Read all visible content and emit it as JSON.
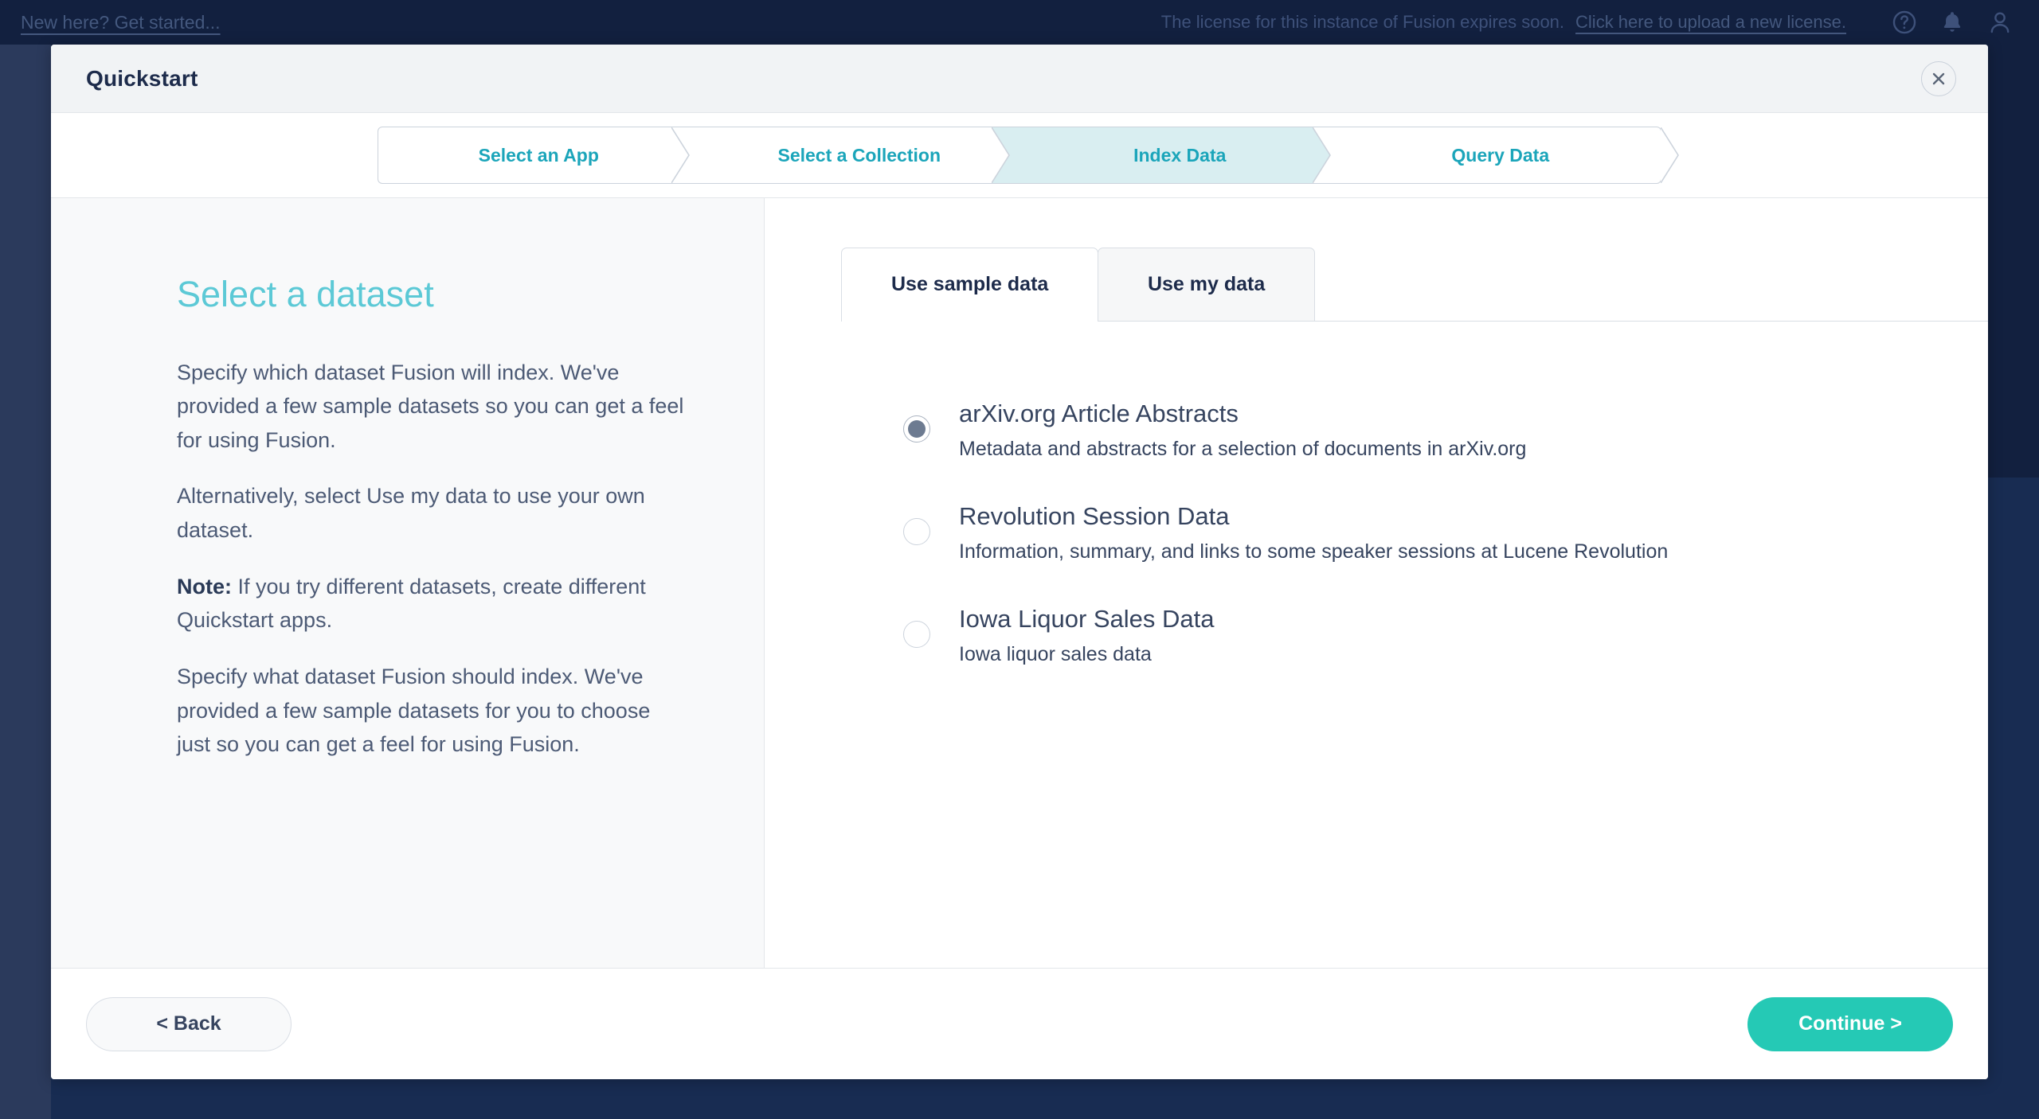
{
  "topbar": {
    "get_started_link": "New here? Get started...",
    "license_message": "The license for this instance of Fusion expires soon.",
    "license_link": "Click here to upload a new license.",
    "icons": [
      "help-icon",
      "notifications-bell-icon",
      "user-account-icon"
    ]
  },
  "modal": {
    "title": "Quickstart",
    "close_label": "×"
  },
  "steps": [
    {
      "label": "Select an App",
      "active": false
    },
    {
      "label": "Select a Collection",
      "active": false
    },
    {
      "label": "Index Data",
      "active": true
    },
    {
      "label": "Query Data",
      "active": false
    }
  ],
  "left_pane": {
    "heading": "Select a dataset",
    "paragraphs": [
      {
        "text": "Specify which dataset Fusion will index. We've provided a few sample datasets so you can get a feel for using Fusion.",
        "lead": ""
      },
      {
        "text": "Alternatively, select Use my data to use your own dataset.",
        "lead": ""
      },
      {
        "text": "If you try different datasets, create different Quickstart apps.",
        "lead": "Note:"
      },
      {
        "text": "Specify what dataset Fusion should index. We've provided a few sample datasets for you to choose just so you can get a feel for using Fusion.",
        "lead": ""
      }
    ]
  },
  "tabs": [
    {
      "label": "Use sample data",
      "active": true
    },
    {
      "label": "Use my data",
      "active": false
    }
  ],
  "datasets": [
    {
      "name": "arXiv.org Article Abstracts",
      "description": "Metadata and abstracts for a selection of documents in arXiv.org",
      "selected": true
    },
    {
      "name": "Revolution Session Data",
      "description": "Information, summary, and links to some speaker sessions at Lucene Revolution",
      "selected": false
    },
    {
      "name": "Iowa Liquor Sales Data",
      "description": "Iowa liquor sales data",
      "selected": false
    }
  ],
  "footer": {
    "back_label": "< Back",
    "continue_label": "Continue >"
  },
  "colors": {
    "accent_teal": "#25c9b5",
    "step_text": "#1ba5ba",
    "step_active_bg": "#d9eef1",
    "heading_teal": "#5cc9d6",
    "app_navy": "#12203f"
  }
}
